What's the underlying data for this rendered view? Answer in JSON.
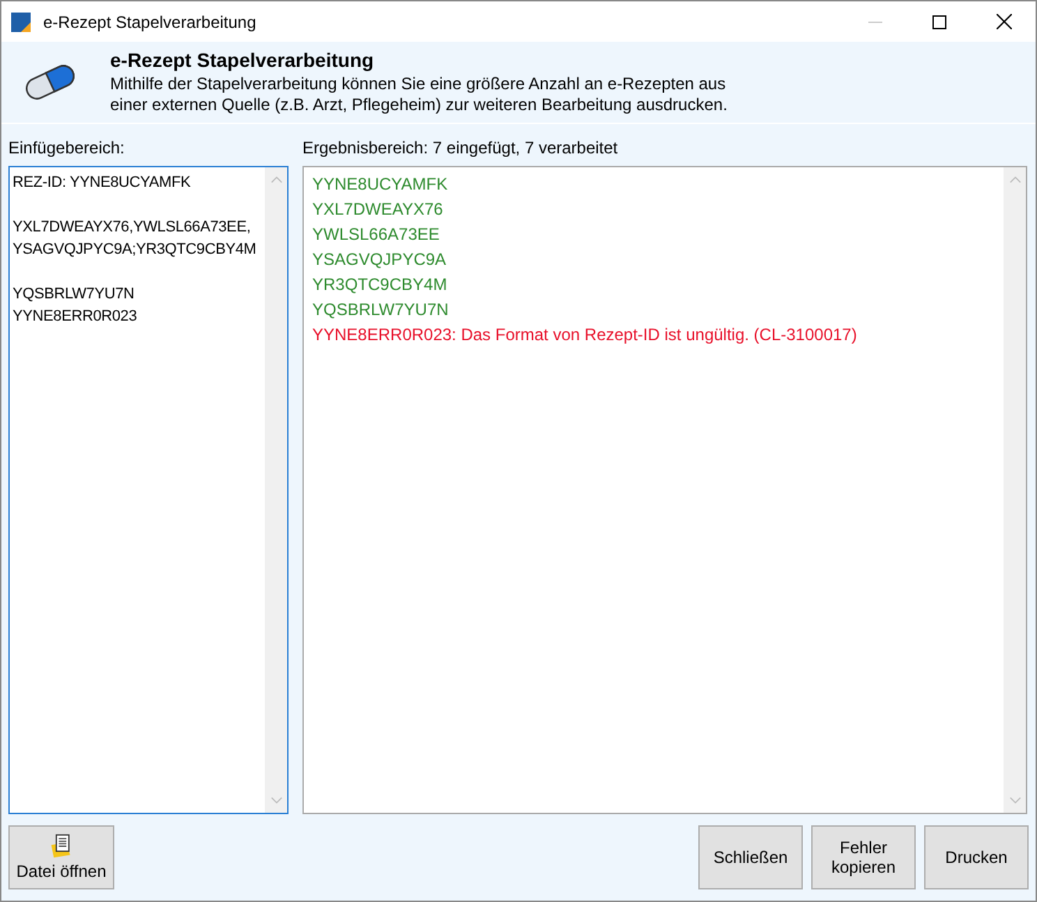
{
  "window": {
    "title": "e-Rezept Stapelverarbeitung",
    "minimize_disabled": true
  },
  "header": {
    "title": "e-Rezept Stapelverarbeitung",
    "description": "Mithilfe der Stapelverarbeitung können Sie eine größere Anzahl an e-Rezepten aus einer externen Quelle (z.B. Arzt, Pflegeheim) zur weiteren Bearbeitung ausdrucken."
  },
  "input_area": {
    "label": "Einfügebereich:",
    "value": "REZ-ID: YYNE8UCYAMFK\n\nYXL7DWEAYX76,YWLSL66A73EE,\nYSAGVQJPYC9A;YR3QTC9CBY4M\n\nYQSBRLW7YU7N\nYYNE8ERR0R023"
  },
  "result_area": {
    "label": "Ergebnisbereich: 7 eingefügt, 7 verarbeitet",
    "lines": [
      {
        "text": "YYNE8UCYAMFK",
        "kind": "ok"
      },
      {
        "text": "YXL7DWEAYX76",
        "kind": "ok"
      },
      {
        "text": "YWLSL66A73EE",
        "kind": "ok"
      },
      {
        "text": "YSAGVQJPYC9A",
        "kind": "ok"
      },
      {
        "text": "YR3QTC9CBY4M",
        "kind": "ok"
      },
      {
        "text": "YQSBRLW7YU7N",
        "kind": "ok"
      },
      {
        "text": "YYNE8ERR0R023: Das Format von Rezept-ID ist ungültig. (CL-3100017)",
        "kind": "error"
      }
    ]
  },
  "buttons_left": [
    {
      "label": "Datei öffnen"
    }
  ],
  "buttons_right": [
    {
      "label": "Schließen"
    },
    {
      "label": "Fehler kopieren"
    },
    {
      "label": "Drucken"
    }
  ]
}
